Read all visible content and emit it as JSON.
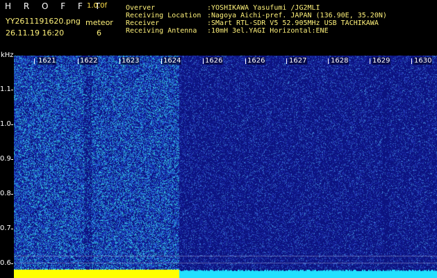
{
  "header": {
    "brand": "H R O F F T",
    "version": "1.0.0f",
    "filename": "YY2611191620.png",
    "datetime": "26.11.19 16:20",
    "event_type": "meteor",
    "event_count": "6"
  },
  "station_info": [
    {
      "key": "Overver",
      "value": ":YOSHIKAWA Yasufumi /JG2MLI"
    },
    {
      "key": "Receiving Location",
      "value": ":Nagoya Aichi-pref. JAPAN (136.90E, 35.20N)"
    },
    {
      "key": "Receiver",
      "value": ":SMart RTL-SDR V5 52.905MHz USB TACHIKAWA"
    },
    {
      "key": "Receiving Antenna",
      "value": ":10mH 3el.YAGI Horizontal:ENE"
    }
  ],
  "axis": {
    "unit": "kHz",
    "y_ticks": [
      "1.1",
      "1.0",
      "0.9",
      "0.8",
      "0.7",
      "0.6"
    ],
    "x_minutes": [
      "1621",
      "1622",
      "1623",
      "1624",
      "1626",
      "1626",
      "1627",
      "1628",
      "1629",
      "1630"
    ]
  },
  "spectrogram": {
    "freq_range_khz": [
      0.58,
      1.16
    ],
    "time_range": [
      "16:20",
      "16:30"
    ],
    "high_noise_until_minute": 1624,
    "colors": {
      "background": "#0c1380",
      "high_noise": [
        "#1f4fd8",
        "#2f8fe0",
        "#32c6d8",
        "#1a2fb8"
      ],
      "low_noise": [
        "#1b28a8",
        "#2a46c8",
        "#3a7ad0",
        "#0e1888"
      ],
      "baseline_left": "#ffff00",
      "baseline_right": "#22e0ff"
    }
  }
}
